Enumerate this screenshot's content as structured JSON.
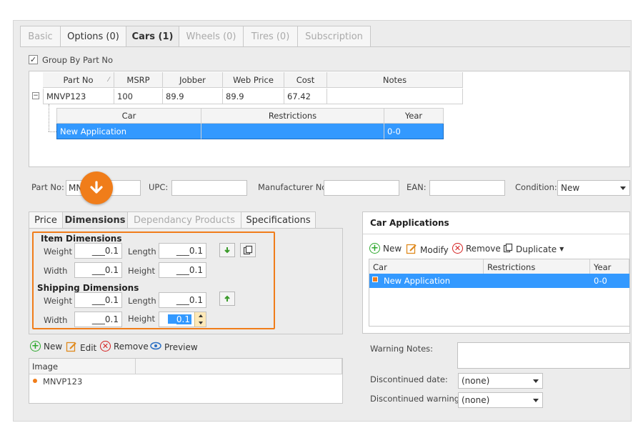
{
  "tabs": [
    "Basic",
    "Options (0)",
    "Cars (1)",
    "Wheels (0)",
    "Tires (0)",
    "Subscription"
  ],
  "group_by": {
    "label": "Group By Part No",
    "checked": true
  },
  "parts_grid": {
    "columns": [
      "Part No",
      "MSRP",
      "Jobber",
      "Web Price",
      "Cost",
      "Notes"
    ],
    "row": [
      "MNVP123",
      "100",
      "89.9",
      "89.9",
      "67.42",
      ""
    ],
    "expand_symbol": "−"
  },
  "car_grid": {
    "columns": [
      "Car",
      "Restrictions",
      "Year"
    ],
    "row": [
      "New Application",
      "",
      "0-0"
    ]
  },
  "fields": {
    "part_no_label": "Part No:",
    "part_no_value": "MN",
    "upc_label": "UPC:",
    "upc_value": "",
    "manufacturer_label": "Manufacturer No:",
    "manufacturer_value": "",
    "ean_label": "EAN:",
    "ean_value": "",
    "condition_label": "Condition:",
    "condition_value": "New"
  },
  "subtabs": [
    "Price",
    "Dimensions",
    "Dependancy Products",
    "Specifications"
  ],
  "dimensions": {
    "item_title": "Item Dimensions",
    "shipping_title": "Shipping Dimensions",
    "weight_label": "Weight",
    "length_label": "Length",
    "width_label": "Width",
    "height_label": "Height",
    "item": {
      "weight": "___0.1",
      "length": "___0.1",
      "width": "___0.1",
      "height": "___0.1"
    },
    "shipping": {
      "weight": "___0.1",
      "length": "___0.1",
      "width": "___0.1",
      "height": "___0.1"
    },
    "active_value": "0.1",
    "active_prefix": "__"
  },
  "image_toolbar": {
    "new": "New",
    "edit": "Edit",
    "remove": "Remove",
    "preview": "Preview"
  },
  "image_grid": {
    "column": "Image",
    "row": "MNVP123"
  },
  "car_apps": {
    "title": "Car Applications",
    "toolbar": {
      "new": "New",
      "modify": "Modify",
      "remove": "Remove",
      "duplicate": "Duplicate"
    },
    "columns": [
      "Car",
      "Restrictions",
      "Year"
    ],
    "row": [
      "New Application",
      "",
      "0-0"
    ]
  },
  "warning": {
    "notes_label": "Warning Notes:",
    "notes_value": "",
    "discontinued_date_label": "Discontinued date:",
    "discontinued_date_value": "(none)",
    "discontinued_warning_label": "Discontinued warning:",
    "discontinued_warning_value": "(none)"
  },
  "colors": {
    "accent": "#f07d1a",
    "selection": "#3399ff",
    "orange_badge": "#f07d1a"
  }
}
